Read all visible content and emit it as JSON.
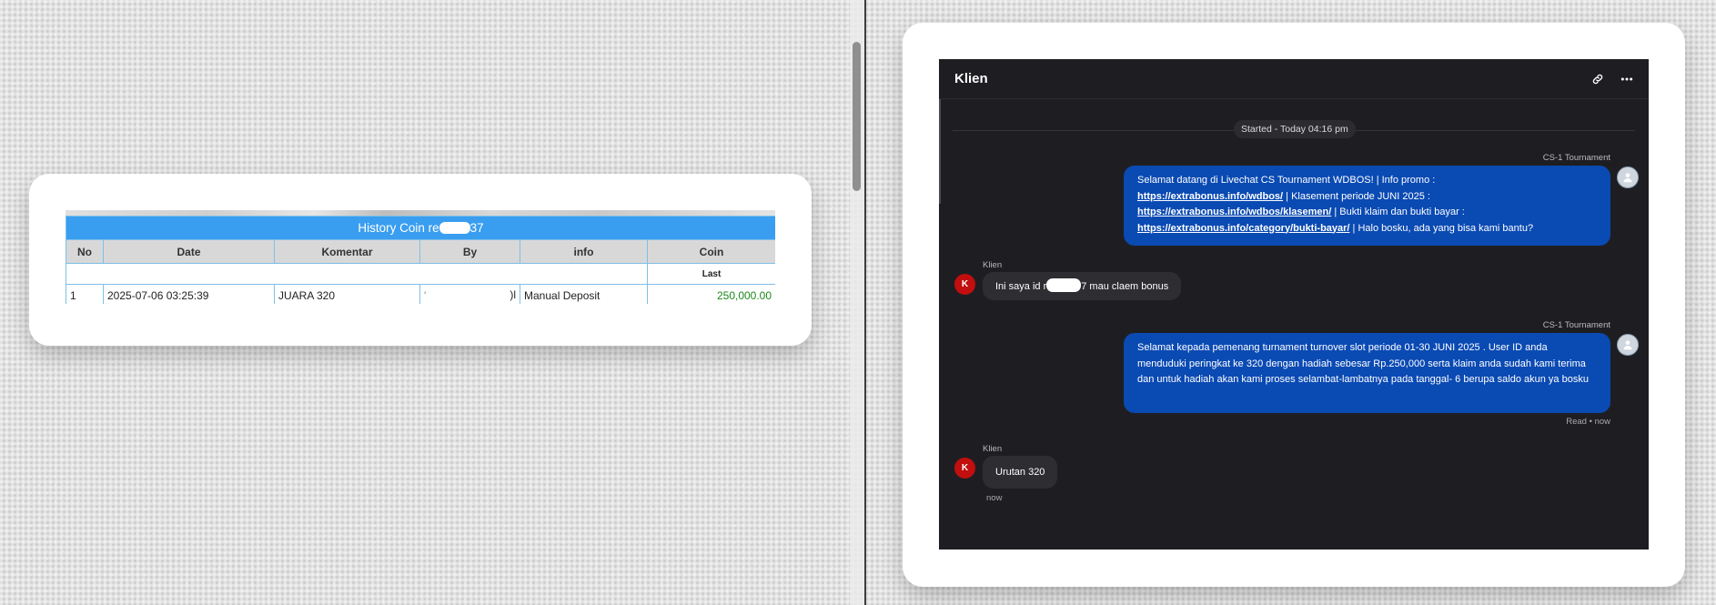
{
  "history_table": {
    "title_prefix": "History Coin re",
    "title_suffix": "37",
    "columns": [
      "No",
      "Date",
      "Komentar",
      "By",
      "info",
      "Coin"
    ],
    "last_label": "Last",
    "rows": [
      {
        "no": "1",
        "date": "2025-07-06 03:25:39",
        "komentar": "JUARA 320",
        "by_left": "'",
        "by_right": ")l",
        "info": "Manual Deposit",
        "coin": "250,000.00"
      }
    ]
  },
  "chat": {
    "title": "Klien",
    "started": "Started - Today 04:16 pm",
    "icons": {
      "link": "link-icon",
      "more": "more-icon"
    },
    "messages": [
      {
        "sender": "CS-1 Tournament",
        "line1": "Selamat datang di Livechat CS Tournament WDBOS! | Info promo :",
        "link1": "https://extrabonus.info/wdbos/",
        "text2": " | Klasement periode JUNI 2025 :",
        "link2": "https://extrabonus.info/wdbos/klasemen/",
        "text3": " | Bukti klaim dan bukti bayar :",
        "link3": "https://extrabonus.info/category/bukti-bayar/",
        "text4": " | Halo bosku, ada yang bisa kami bantu?"
      },
      {
        "sender": "Klien",
        "avatar": "K",
        "text_prefix": "Ini saya id r",
        "text_suffix": "7 mau claem bonus"
      },
      {
        "sender": "CS-1 Tournament",
        "text": "Selamat kepada pemenang turnament turnover slot periode 01-30 JUNI 2025 . User ID anda menduduki peringkat ke 320 dengan hadiah sebesar Rp.250,000 serta klaim anda sudah kami terima dan untuk hadiah akan kami proses selambat-lambatnya pada tanggal- 6 berupa saldo akun ya bosku",
        "status": "Read • now"
      },
      {
        "sender": "Klien",
        "avatar": "K",
        "text": "Urutan 320",
        "time": "now"
      }
    ]
  }
}
